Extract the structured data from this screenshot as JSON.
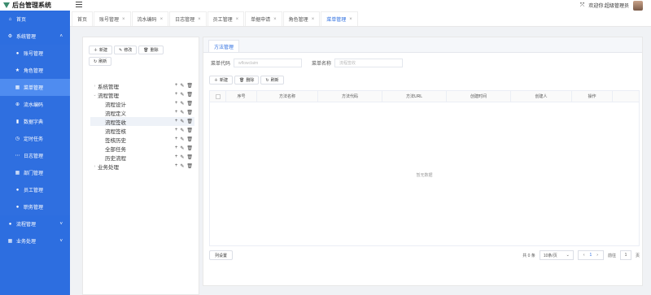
{
  "app": {
    "title": "后台管理系统",
    "welcome": "欢迎你:超级管理员"
  },
  "sidebar": {
    "items": [
      {
        "label": "首页",
        "icon": "home-icon",
        "glyph": "⌂",
        "level": 1
      },
      {
        "label": "系统管理",
        "icon": "gear-icon",
        "glyph": "⚙",
        "level": 1,
        "caret": "˄"
      },
      {
        "label": "账号管理",
        "icon": "user-icon",
        "glyph": "●",
        "level": 2
      },
      {
        "label": "角色管理",
        "icon": "star-icon",
        "glyph": "★",
        "level": 2
      },
      {
        "label": "菜单管理",
        "icon": "grid-icon",
        "glyph": "▦",
        "level": 2,
        "active": true
      },
      {
        "label": "流水编码",
        "icon": "plus-circle-icon",
        "glyph": "⊕",
        "level": 2
      },
      {
        "label": "数据字典",
        "icon": "chart-icon",
        "glyph": "▮",
        "level": 2
      },
      {
        "label": "定时任务",
        "icon": "clock-icon",
        "glyph": "◷",
        "level": 2
      },
      {
        "label": "日志管理",
        "icon": "dots-icon",
        "glyph": "⋯",
        "level": 2
      },
      {
        "label": "部门管理",
        "icon": "grid-icon",
        "glyph": "▦",
        "level": 2
      },
      {
        "label": "员工管理",
        "icon": "user-icon",
        "glyph": "●",
        "level": 2
      },
      {
        "label": "职务管理",
        "icon": "user-icon",
        "glyph": "●",
        "level": 2
      },
      {
        "label": "流程管理",
        "icon": "user-icon",
        "glyph": "●",
        "level": 1,
        "caret": "˅"
      },
      {
        "label": "业务处理",
        "icon": "grid-icon",
        "glyph": "▦",
        "level": 1,
        "caret": "˅"
      }
    ]
  },
  "tabs": [
    {
      "label": "首页",
      "closable": false
    },
    {
      "label": "账号管理",
      "closable": true
    },
    {
      "label": "流水编码",
      "closable": true
    },
    {
      "label": "日志管理",
      "closable": true
    },
    {
      "label": "员工管理",
      "closable": true
    },
    {
      "label": "单据申请",
      "closable": true
    },
    {
      "label": "角色管理",
      "closable": true
    },
    {
      "label": "菜单管理",
      "closable": true,
      "active": true
    }
  ],
  "left": {
    "buttons": {
      "new": "新建",
      "edit": "修改",
      "delete": "删除",
      "refresh": "刷新"
    },
    "tree": [
      {
        "label": "系统管理",
        "level": 0,
        "arrow": "›"
      },
      {
        "label": "流程管理",
        "level": 0,
        "arrow": "⌄"
      },
      {
        "label": "流程设计",
        "level": 1
      },
      {
        "label": "流程定义",
        "level": 1
      },
      {
        "label": "流程签收",
        "level": 1,
        "selected": true
      },
      {
        "label": "流程签核",
        "level": 1
      },
      {
        "label": "签核历史",
        "level": 1
      },
      {
        "label": "全部任务",
        "level": 1
      },
      {
        "label": "历史流程",
        "level": 1
      },
      {
        "label": "业务处理",
        "level": 0,
        "arrow": "›"
      }
    ]
  },
  "right": {
    "tab": "方法管理",
    "search": {
      "menu_code_label": "菜单代码",
      "menu_code_value": "wflowclaim",
      "menu_name_label": "菜单名称",
      "menu_name_value": "流程签收"
    },
    "buttons": {
      "new": "新建",
      "delete": "删除",
      "refresh": "刷新"
    },
    "columns": [
      "序号",
      "方法名称",
      "方法代码",
      "方法URL",
      "创建时间",
      "创建人",
      "操作"
    ],
    "empty_text": "暂无数据",
    "column_setting": "列设置",
    "pager": {
      "total": "共 0 条",
      "size": "10条/页",
      "page": "1",
      "goto_label": "前往",
      "goto_value": "1",
      "page_unit": "页"
    }
  },
  "colors": {
    "sidebar": "#2d6ee0",
    "sidebar_active": "#4f8cf0",
    "accent": "#2d6ee0"
  }
}
